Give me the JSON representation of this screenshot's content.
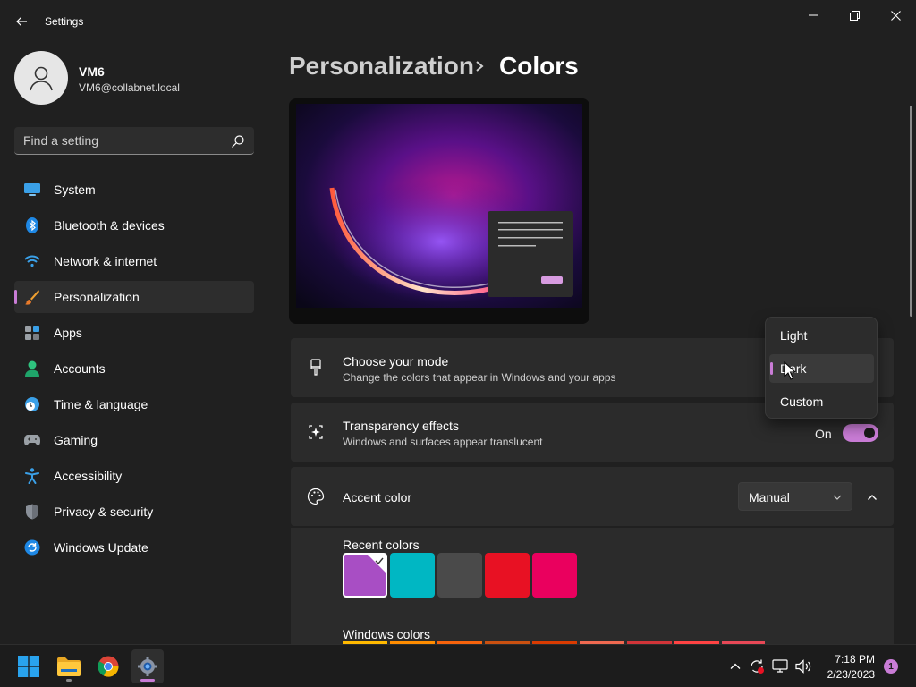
{
  "window": {
    "title": "Settings"
  },
  "user": {
    "name": "VM6",
    "email": "VM6@collabnet.local"
  },
  "search": {
    "placeholder": "Find a setting"
  },
  "sidebar": {
    "items": [
      {
        "label": "System",
        "icon": "system-icon",
        "active": false
      },
      {
        "label": "Bluetooth & devices",
        "icon": "bluetooth-icon",
        "active": false
      },
      {
        "label": "Network & internet",
        "icon": "wifi-icon",
        "active": false
      },
      {
        "label": "Personalization",
        "icon": "brush-icon",
        "active": true
      },
      {
        "label": "Apps",
        "icon": "apps-icon",
        "active": false
      },
      {
        "label": "Accounts",
        "icon": "accounts-icon",
        "active": false
      },
      {
        "label": "Time & language",
        "icon": "clock-globe-icon",
        "active": false
      },
      {
        "label": "Gaming",
        "icon": "gamepad-icon",
        "active": false
      },
      {
        "label": "Accessibility",
        "icon": "accessibility-icon",
        "active": false
      },
      {
        "label": "Privacy & security",
        "icon": "shield-icon",
        "active": false
      },
      {
        "label": "Windows Update",
        "icon": "update-icon",
        "active": false
      }
    ]
  },
  "breadcrumb": {
    "parent": "Personalization",
    "current": "Colors"
  },
  "mode_card": {
    "title": "Choose your mode",
    "description": "Change the colors that appear in Windows and your apps"
  },
  "transparency_card": {
    "title": "Transparency effects",
    "description": "Windows and surfaces appear translucent",
    "state_label": "On",
    "enabled": true
  },
  "accent_card": {
    "title": "Accent color",
    "selected": "Manual",
    "recent_label": "Recent colors",
    "windows_label": "Windows colors",
    "recent_colors": [
      "#a84ec4",
      "#00b7c3",
      "#4a4a4a",
      "#e81123",
      "#ea005e"
    ],
    "windows_colors": [
      "#ffb900",
      "#ff8c00",
      "#f7630c",
      "#ca5010",
      "#da3b01",
      "#ef6950",
      "#d13438",
      "#ff4343",
      "#e74856"
    ]
  },
  "mode_dropdown": {
    "options": [
      "Light",
      "Dark",
      "Custom"
    ],
    "selected": "Dark"
  },
  "taskbar": {
    "time": "7:18 PM",
    "date": "2/23/2023",
    "notification_count": "1"
  },
  "colors": {
    "accent": "#c97cd6",
    "background": "#202020",
    "card": "#2b2b2b"
  }
}
